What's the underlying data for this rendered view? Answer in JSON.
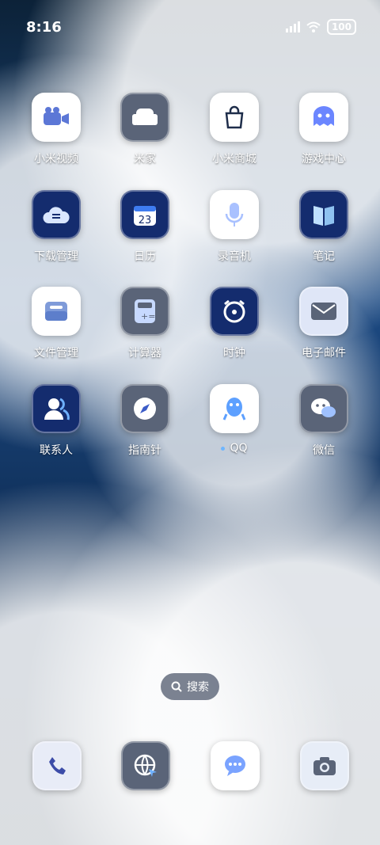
{
  "status": {
    "time": "8:16",
    "battery": "100",
    "signal_icon": "signal-icon",
    "wifi_icon": "wifi-icon"
  },
  "apps": [
    [
      {
        "label": "小米视频",
        "icon": "video-camera-icon",
        "bg": "#ffffff",
        "fg": "#5c77d6"
      },
      {
        "label": "米家",
        "icon": "sofa-icon",
        "bg": "#5a6478",
        "fg": "#ffffff"
      },
      {
        "label": "小米商城",
        "icon": "shopping-bag-icon",
        "bg": "#ffffff",
        "fg": "#1e2d4a"
      },
      {
        "label": "游戏中心",
        "icon": "ghost-icon",
        "bg": "#ffffff",
        "fg": "#6b86ff"
      }
    ],
    [
      {
        "label": "下载管理",
        "icon": "cloud-download-icon",
        "bg": "#142c6e",
        "fg": "#d9e6ff"
      },
      {
        "label": "日历",
        "icon": "calendar-icon",
        "bg": "#142c6e",
        "fg": "#ffffff",
        "badge": "23"
      },
      {
        "label": "录音机",
        "icon": "microphone-icon",
        "bg": "#ffffff",
        "fg": "#a9c1ff"
      },
      {
        "label": "笔记",
        "icon": "notebook-icon",
        "bg": "#142c6e",
        "fg": "#bfe0ff"
      }
    ],
    [
      {
        "label": "文件管理",
        "icon": "folder-icon",
        "bg": "#ffffff",
        "fg": "#7f9bd9"
      },
      {
        "label": "计算器",
        "icon": "calculator-icon",
        "bg": "#5a6478",
        "fg": "#c7d9ff"
      },
      {
        "label": "时钟",
        "icon": "clock-icon",
        "bg": "#142c6e",
        "fg": "#ffffff"
      },
      {
        "label": "电子邮件",
        "icon": "mail-icon",
        "bg": "#dfe6f7",
        "fg": "#5a6478"
      }
    ],
    [
      {
        "label": "联系人",
        "icon": "contacts-icon",
        "bg": "#142c6e",
        "fg": "#ffffff"
      },
      {
        "label": "指南针",
        "icon": "compass-icon",
        "bg": "#5a6478",
        "fg": "#ffffff"
      },
      {
        "label": "QQ",
        "icon": "penguin-icon",
        "bg": "#ffffff",
        "fg": "#5da0ff",
        "dot": true
      },
      {
        "label": "微信",
        "icon": "chat-bubbles-icon",
        "bg": "#5a6478",
        "fg": "#ffffff"
      }
    ]
  ],
  "search": {
    "label": "搜索",
    "icon": "search-icon"
  },
  "dock": [
    {
      "icon": "phone-icon",
      "bg": "#e8ecf7",
      "fg": "#3c4ca8"
    },
    {
      "icon": "browser-globe-icon",
      "bg": "#142c6e",
      "fg": "#ffffff"
    },
    {
      "icon": "message-icon",
      "bg": "#ffffff",
      "fg": "#7aa3ff"
    },
    {
      "icon": "camera-icon",
      "bg": "#e7edf7",
      "fg": "#5a6478"
    }
  ]
}
